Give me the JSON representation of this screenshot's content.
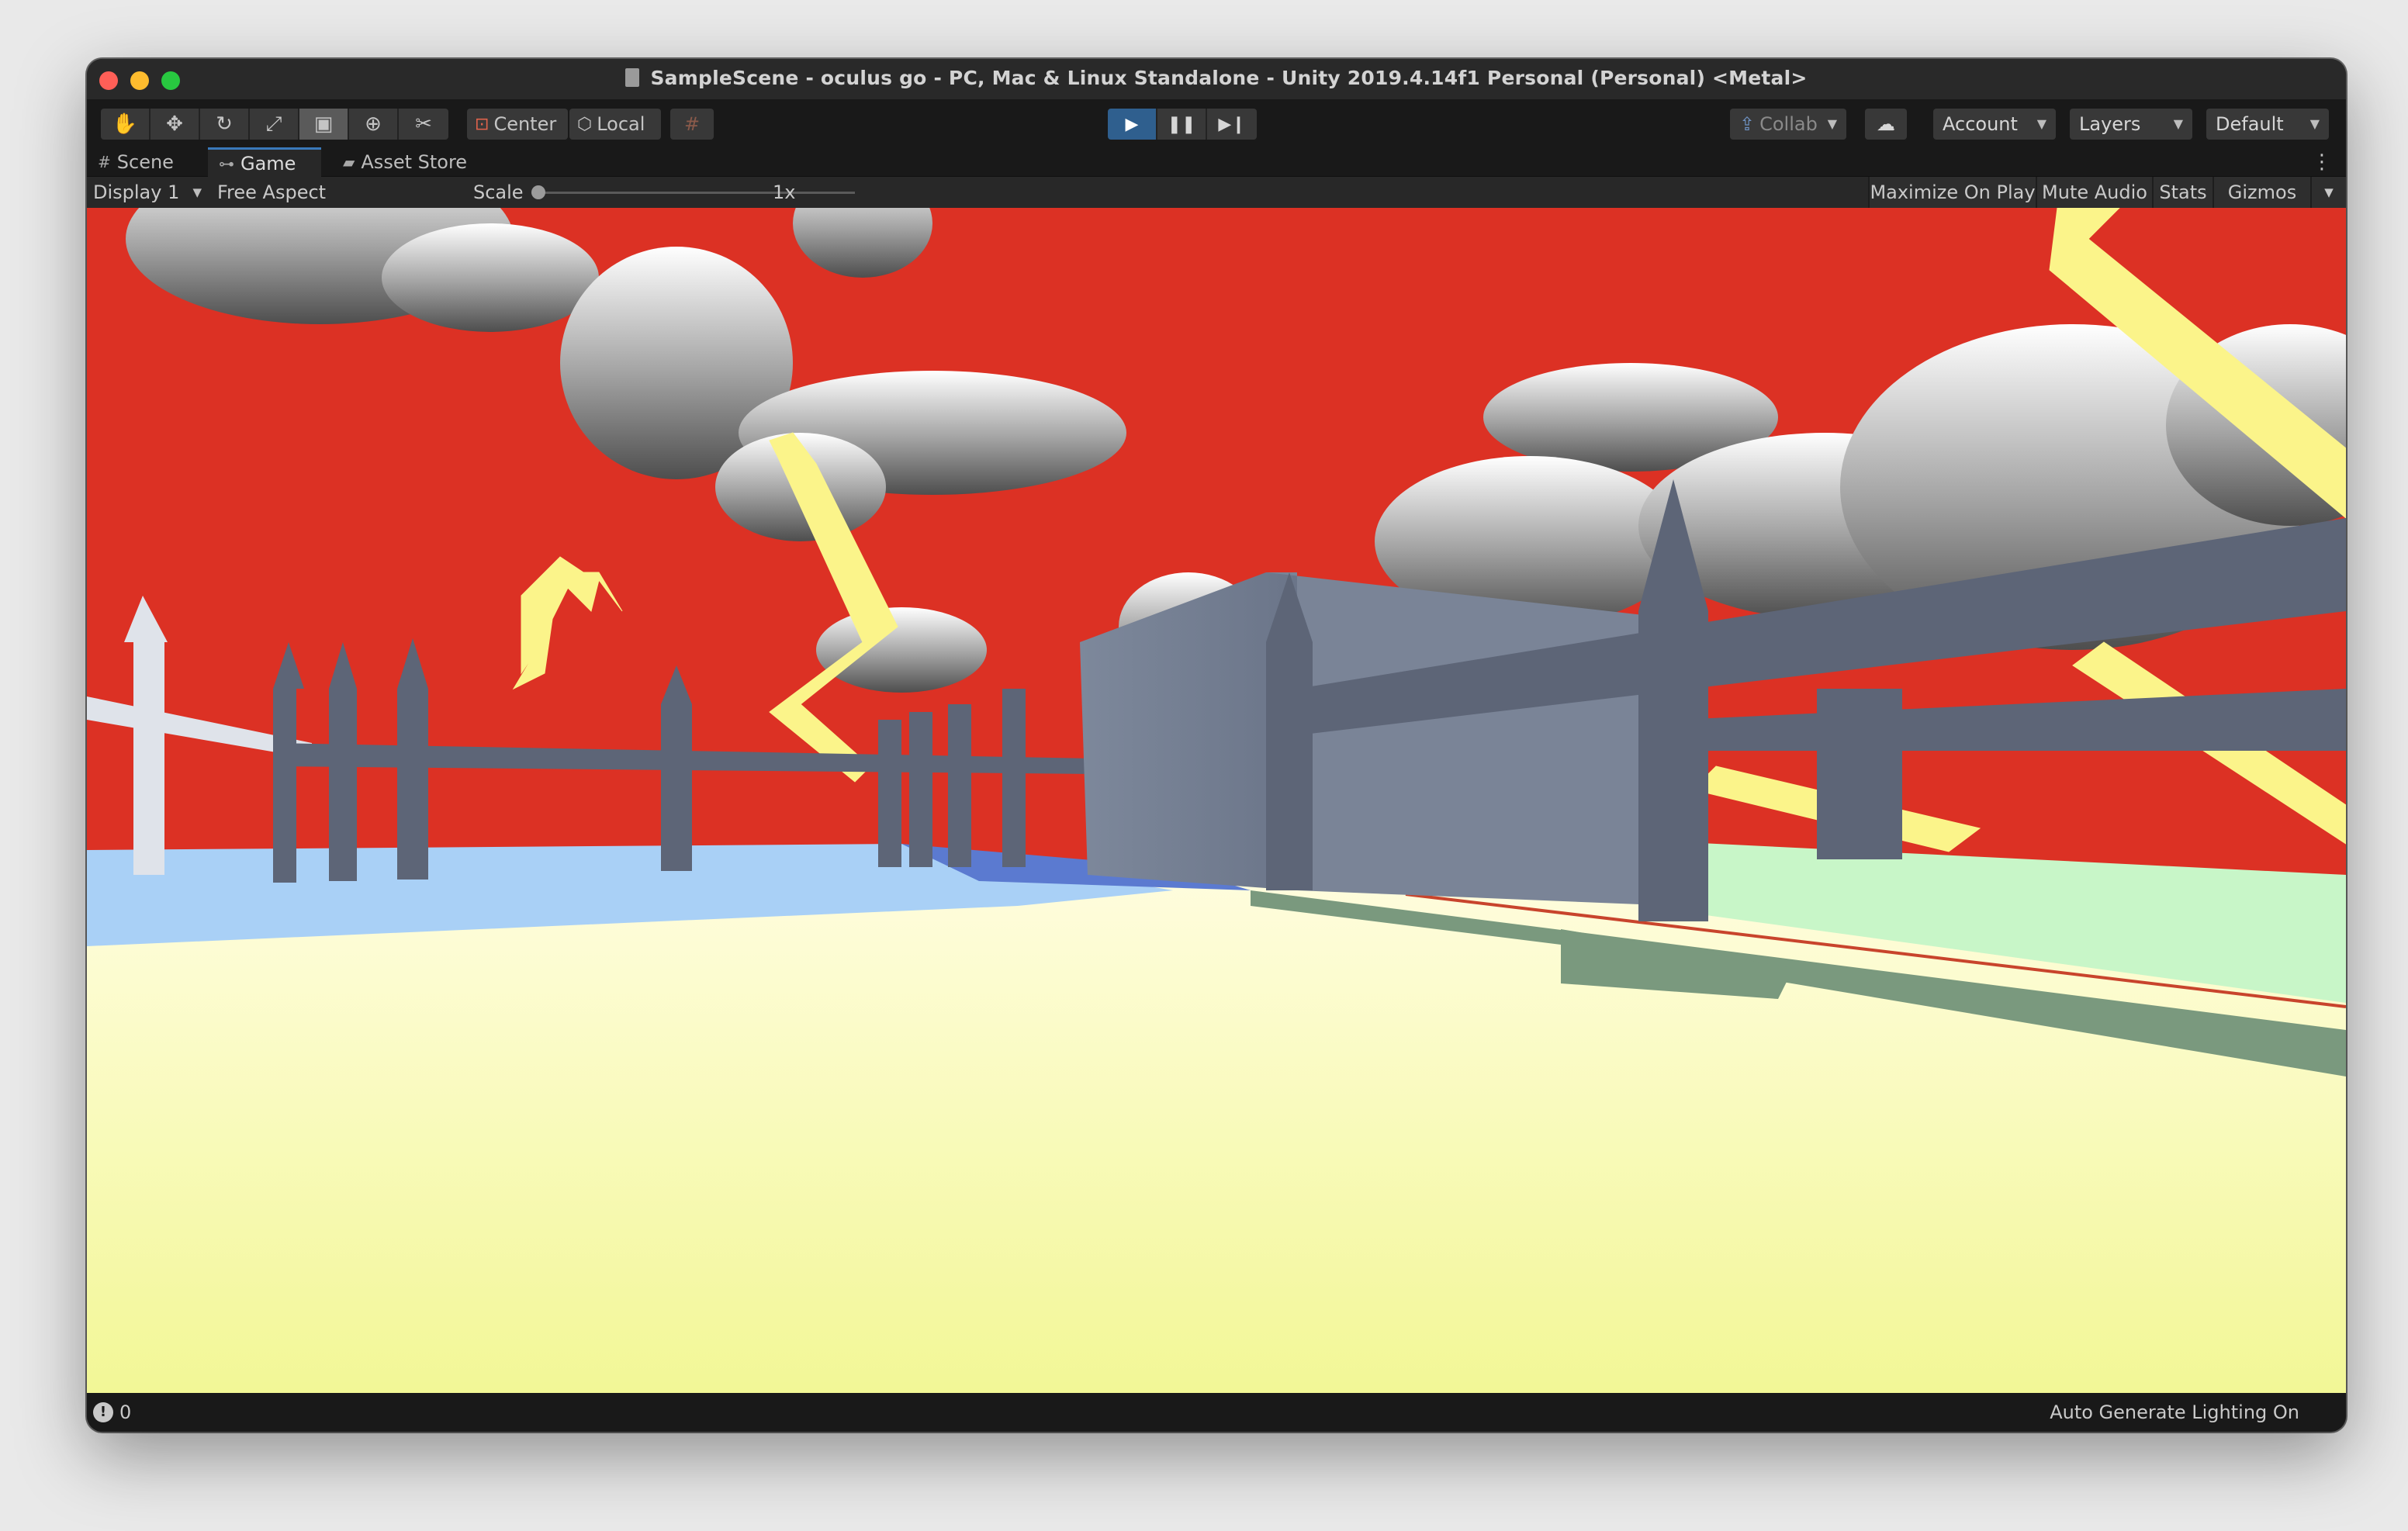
{
  "window": {
    "title": "SampleScene - oculus go - PC, Mac & Linux Standalone - Unity 2019.4.14f1 Personal (Personal) <Metal>"
  },
  "toolbar": {
    "tools": [
      {
        "name": "hand-tool",
        "glyph": "✋"
      },
      {
        "name": "move-tool",
        "glyph": "✥"
      },
      {
        "name": "rotate-tool",
        "glyph": "↻"
      },
      {
        "name": "scale-tool",
        "glyph": "⤢"
      },
      {
        "name": "rect-tool",
        "glyph": "▣"
      },
      {
        "name": "transform-tool",
        "glyph": "⊕"
      },
      {
        "name": "custom-tool",
        "glyph": "✂"
      }
    ],
    "pivot_label": "Center",
    "space_label": "Local",
    "collab_label": "Collab",
    "account_label": "Account",
    "layers_label": "Layers",
    "layout_label": "Default"
  },
  "tabs": {
    "scene": "Scene",
    "game": "Game",
    "asset_store": "Asset Store"
  },
  "game_toolbar": {
    "display": "Display 1",
    "aspect": "Free Aspect",
    "scale_label": "Scale",
    "scale_value": "1x",
    "scale_level": 0,
    "maximize_on_play": "Maximize On Play",
    "mute_audio": "Mute Audio",
    "stats": "Stats",
    "gizmos": "Gizmos"
  },
  "status": {
    "count": "0",
    "lighting": "Auto Generate Lighting On"
  },
  "colors": {
    "sky": "#dc3124",
    "ground": "#fdfcc6",
    "water": "#a9d0f6",
    "grass": "#c8f6c8",
    "fence": "#5d6577",
    "lightning": "#fbf48a",
    "play_active": "#2f5f8e"
  }
}
